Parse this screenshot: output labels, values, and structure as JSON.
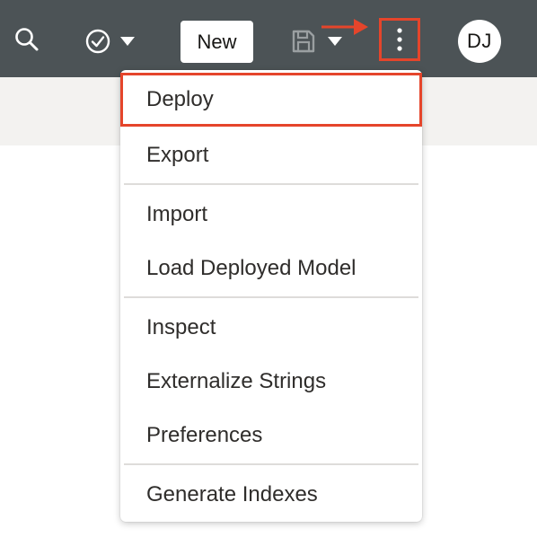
{
  "toolbar": {
    "new_label": "New",
    "avatar_initials": "DJ",
    "icons": {
      "search": "search-icon",
      "validate": "check-circle-icon",
      "validate_menu": "caret-down-icon",
      "save": "floppy-disk-icon",
      "save_menu": "caret-down-icon",
      "more": "vertical-ellipsis-icon"
    }
  },
  "menu": {
    "items": [
      {
        "label": "Deploy",
        "highlighted": true
      },
      {
        "label": "Export"
      },
      {
        "label": "Import"
      },
      {
        "label": "Load Deployed Model"
      },
      {
        "label": "Inspect"
      },
      {
        "label": "Externalize Strings"
      },
      {
        "label": "Preferences"
      },
      {
        "label": "Generate Indexes"
      }
    ]
  },
  "colors": {
    "toolbar_bg": "#4c5356",
    "subbar_bg": "#f3f2f0",
    "highlight": "#e5452b",
    "menu_text": "#2f2d2b"
  }
}
